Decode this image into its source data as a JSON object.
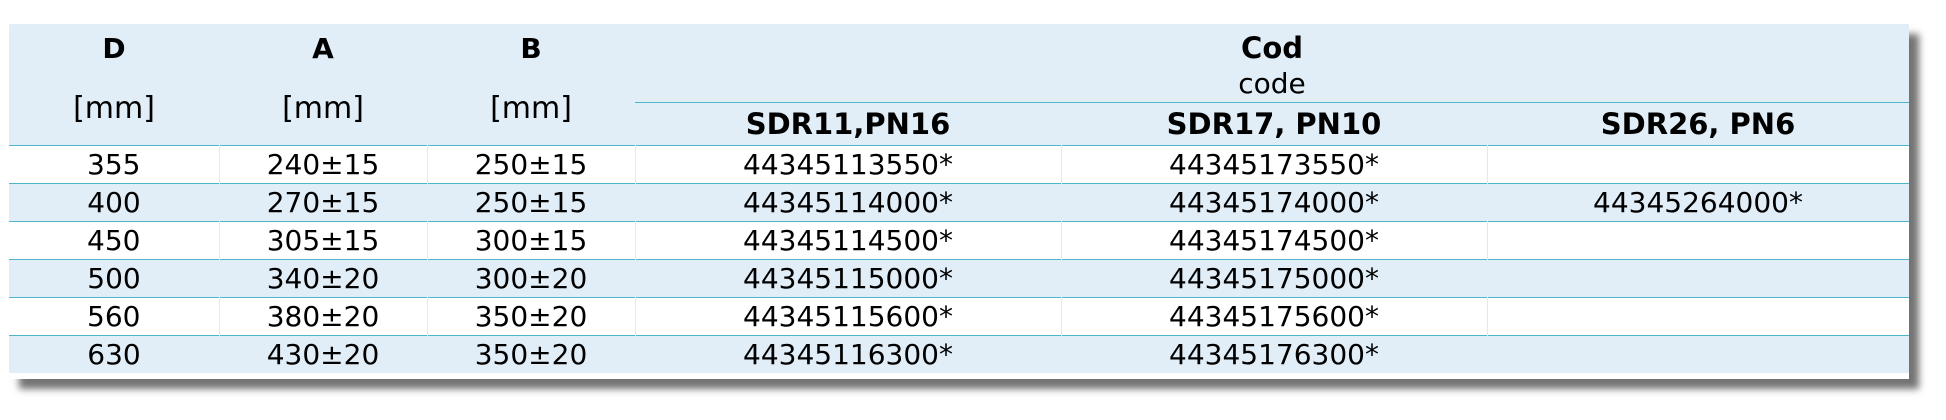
{
  "table": {
    "headers": {
      "d": "D",
      "a": "A",
      "b": "B",
      "unit": "[mm]",
      "cod_title": "Cod",
      "cod_sub": "code",
      "sdr11": "SDR11,PN16",
      "sdr17": "SDR17, PN10",
      "sdr26": "SDR26, PN6"
    },
    "rows": [
      {
        "d": "355",
        "a": "240±15",
        "b": "250±15",
        "sdr11": "44345113550*",
        "sdr17": "44345173550*",
        "sdr26": ""
      },
      {
        "d": "400",
        "a": "270±15",
        "b": "250±15",
        "sdr11": "44345114000*",
        "sdr17": "44345174000*",
        "sdr26": "44345264000*"
      },
      {
        "d": "450",
        "a": "305±15",
        "b": "300±15",
        "sdr11": "44345114500*",
        "sdr17": "44345174500*",
        "sdr26": ""
      },
      {
        "d": "500",
        "a": "340±20",
        "b": "300±20",
        "sdr11": "44345115000*",
        "sdr17": "44345175000*",
        "sdr26": ""
      },
      {
        "d": "560",
        "a": "380±20",
        "b": "350±20",
        "sdr11": "44345115600*",
        "sdr17": "44345175600*",
        "sdr26": ""
      },
      {
        "d": "630",
        "a": "430±20",
        "b": "350±20",
        "sdr11": "44345116300*",
        "sdr17": "44345176300*",
        "sdr26": ""
      }
    ]
  },
  "colors": {
    "header_bg": "#e1eef8",
    "row_shade": "#e1eef8",
    "rule": "#4fb6c9"
  }
}
